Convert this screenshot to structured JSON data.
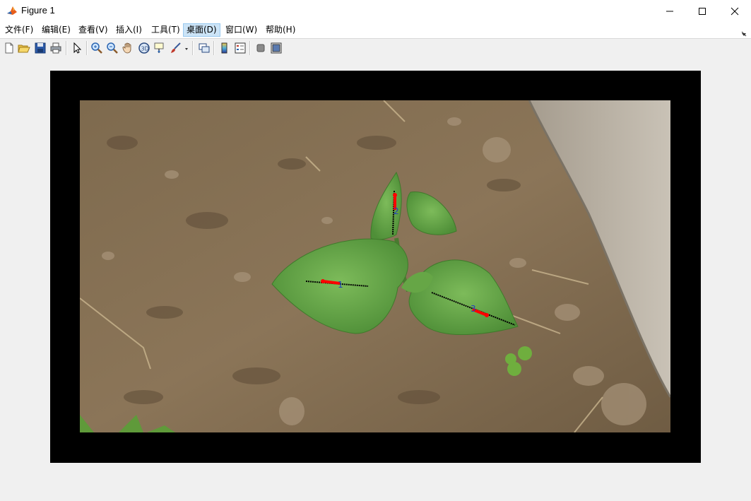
{
  "window": {
    "title": "Figure 1",
    "icon": "matlab-icon"
  },
  "menu": {
    "items": [
      {
        "label": "文件(F)"
      },
      {
        "label": "编辑(E)"
      },
      {
        "label": "查看(V)"
      },
      {
        "label": "插入(I)"
      },
      {
        "label": "工具(T)"
      },
      {
        "label": "桌面(D)"
      },
      {
        "label": "窗口(W)"
      },
      {
        "label": "帮助(H)"
      }
    ],
    "active_index": 5
  },
  "toolbar": {
    "buttons": [
      "new-figure-icon",
      "open-file-icon",
      "save-icon",
      "print-icon",
      "select-arrow-icon",
      "zoom-in-icon",
      "zoom-out-icon",
      "pan-hand-icon",
      "rotate-3d-icon",
      "data-cursor-icon",
      "brush-icon",
      "brush-dropdown-icon",
      "link-plot-icon",
      "insert-colorbar-icon",
      "insert-legend-icon",
      "hide-plot-tools-icon",
      "show-plot-tools-icon"
    ]
  },
  "figure": {
    "image": "soil photo with bean seedling and leaf-axis annotations",
    "annotations": [
      {
        "label": "1"
      },
      {
        "label": "2"
      },
      {
        "label": "3"
      }
    ],
    "colors": {
      "frame": "#000000",
      "axis_line": "#000000",
      "direction_arrow": "#ff0000",
      "label": "#1f3fbf"
    }
  }
}
